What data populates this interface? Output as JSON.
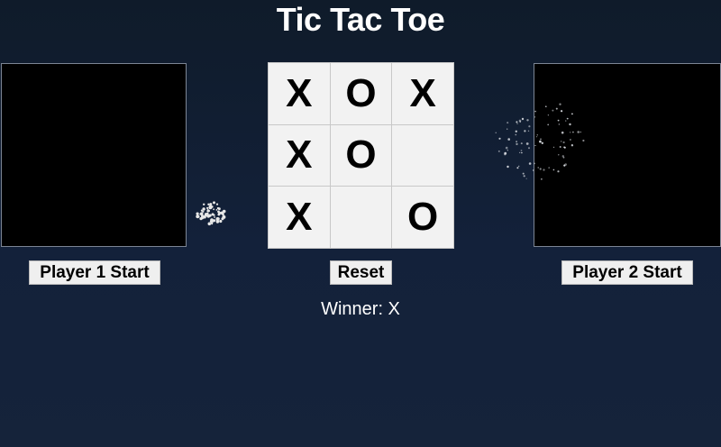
{
  "title": "Tic Tac Toe",
  "board": [
    "X",
    "O",
    "X",
    "X",
    "O",
    "",
    "X",
    "",
    "O"
  ],
  "buttons": {
    "player1": "Player 1 Start",
    "reset": "Reset",
    "player2": "Player 2 Start"
  },
  "winner": "Winner: X",
  "colors": {
    "background": "#0f1b2a",
    "board_cell": "#f2f2f2",
    "panel": "#000000"
  }
}
